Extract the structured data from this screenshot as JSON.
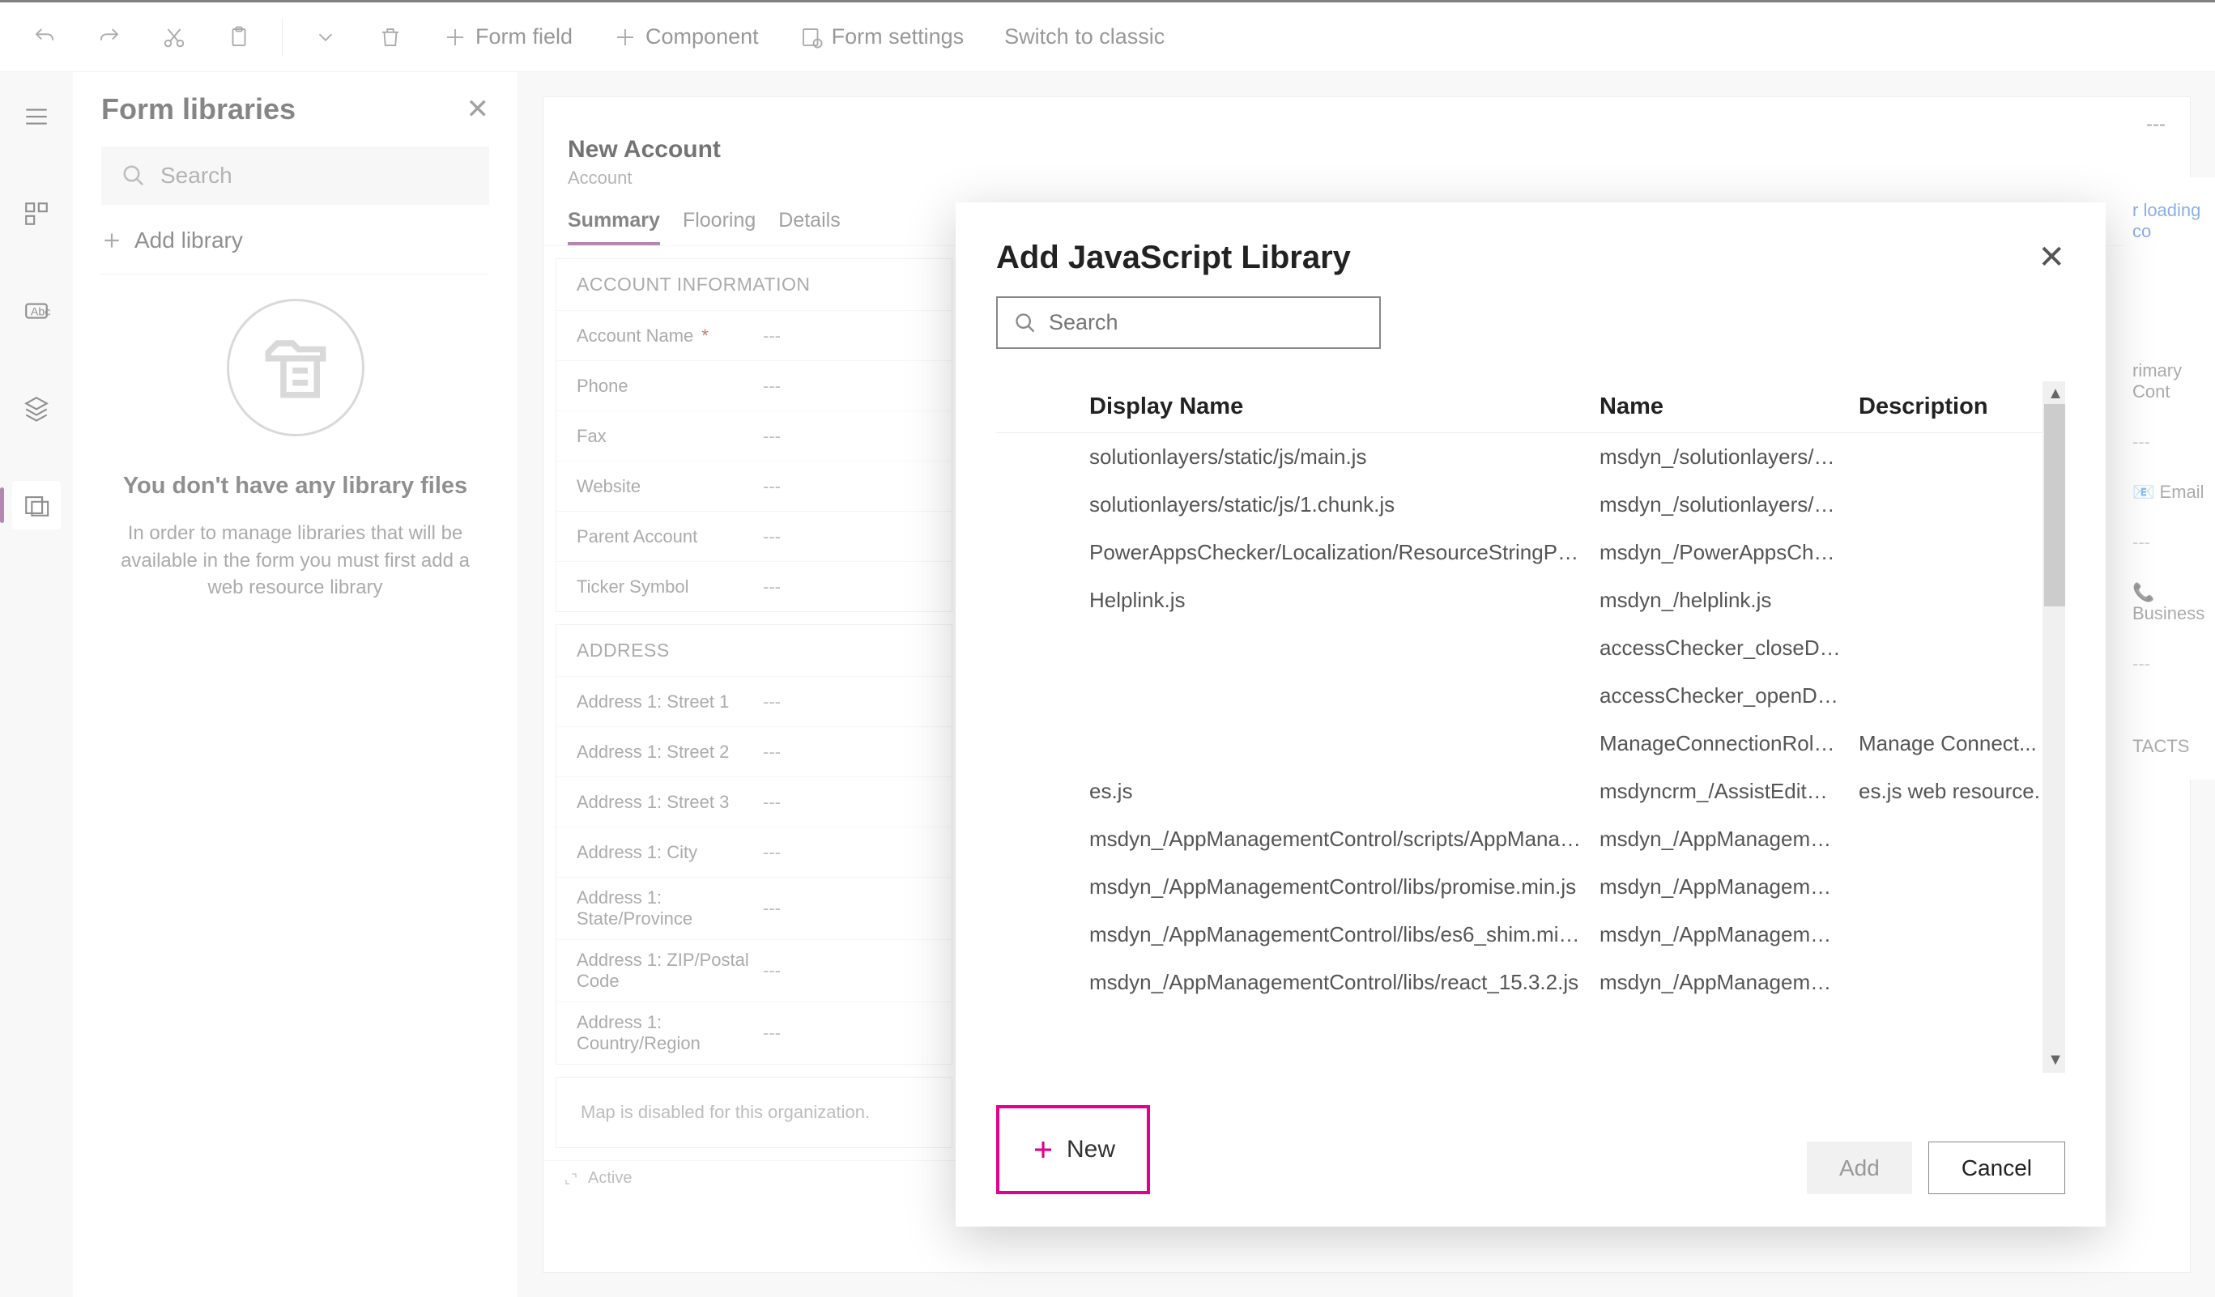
{
  "commandBar": {
    "formField": "Form field",
    "component": "Component",
    "formSettings": "Form settings",
    "switchClassic": "Switch to classic"
  },
  "sidePanel": {
    "title": "Form libraries",
    "searchPlaceholder": "Search",
    "addLibrary": "Add library",
    "emptyTitle": "You don't have any library files",
    "emptyDesc": "In order to manage libraries that will be available in the form you must first add a web resource library"
  },
  "form": {
    "title": "New Account",
    "subtitle": "Account",
    "tabs": [
      "Summary",
      "Flooring",
      "Details"
    ],
    "section1": {
      "title": "ACCOUNT INFORMATION",
      "fields": [
        {
          "label": "Account Name",
          "required": true,
          "value": "---"
        },
        {
          "label": "Phone",
          "required": false,
          "value": "---"
        },
        {
          "label": "Fax",
          "required": false,
          "value": "---"
        },
        {
          "label": "Website",
          "required": false,
          "value": "---"
        },
        {
          "label": "Parent Account",
          "required": false,
          "value": "---"
        },
        {
          "label": "Ticker Symbol",
          "required": false,
          "value": "---"
        }
      ]
    },
    "section2": {
      "title": "ADDRESS",
      "fields": [
        {
          "label": "Address 1: Street 1",
          "value": "---"
        },
        {
          "label": "Address 1: Street 2",
          "value": "---"
        },
        {
          "label": "Address 1: Street 3",
          "value": "---"
        },
        {
          "label": "Address 1: City",
          "value": "---"
        },
        {
          "label": "Address 1: State/Province",
          "value": "---"
        },
        {
          "label": "Address 1: ZIP/Postal Code",
          "value": "---"
        },
        {
          "label": "Address 1: Country/Region",
          "value": "---"
        }
      ]
    },
    "mapMessage": "Map is disabled for this organization.",
    "status": "Active"
  },
  "rightFrag": {
    "loading": "r loading co",
    "primaryContact": "rimary Cont",
    "email": "Email",
    "business": "Business",
    "contacts": "TACTS"
  },
  "modal": {
    "title": "Add JavaScript Library",
    "searchPlaceholder": "Search",
    "columns": {
      "display": "Display Name",
      "name": "Name",
      "desc": "Description"
    },
    "rows": [
      {
        "display": "solutionlayers/static/js/main.js",
        "name": "msdyn_/solutionlayers/st...",
        "desc": ""
      },
      {
        "display": "solutionlayers/static/js/1.chunk.js",
        "name": "msdyn_/solutionlayers/st...",
        "desc": ""
      },
      {
        "display": "PowerAppsChecker/Localization/ResourceStringProvid...",
        "name": "msdyn_/PowerAppsChec...",
        "desc": ""
      },
      {
        "display": "Helplink.js",
        "name": "msdyn_/helplink.js",
        "desc": ""
      },
      {
        "display": "",
        "name": "accessChecker_closeDial...",
        "desc": ""
      },
      {
        "display": "",
        "name": "accessChecker_openDial...",
        "desc": ""
      },
      {
        "display": "",
        "name": "ManageConnectionRoles...",
        "desc": "Manage Connect..."
      },
      {
        "display": "es.js",
        "name": "msdyncrm_/AssistEditCo...",
        "desc": "es.js web resource."
      },
      {
        "display": "msdyn_/AppManagementControl/scripts/AppManage...",
        "name": "msdyn_/AppManagemen...",
        "desc": ""
      },
      {
        "display": "msdyn_/AppManagementControl/libs/promise.min.js",
        "name": "msdyn_/AppManagemen...",
        "desc": ""
      },
      {
        "display": "msdyn_/AppManagementControl/libs/es6_shim.min.js",
        "name": "msdyn_/AppManagemen...",
        "desc": ""
      },
      {
        "display": "msdyn_/AppManagementControl/libs/react_15.3.2.js",
        "name": "msdyn_/AppManagemen...",
        "desc": ""
      }
    ],
    "newLabel": "New",
    "addLabel": "Add",
    "cancelLabel": "Cancel"
  }
}
